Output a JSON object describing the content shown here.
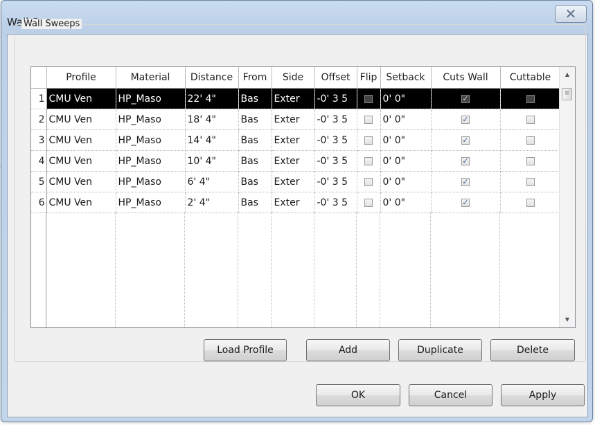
{
  "dialog": {
    "title": "Wall Sweeps",
    "close_glyph": "✕"
  },
  "group": {
    "label": "Wall Sweeps"
  },
  "grid": {
    "columns": [
      "Profile",
      "Material",
      "Distance",
      "From",
      "Side",
      "Offset",
      "Flip",
      "Setback",
      "Cuts Wall",
      "Cuttable"
    ],
    "rows": [
      {
        "num": "1",
        "profile": "CMU Ven",
        "material": "HP_Maso",
        "distance": "22'  4\"",
        "from": "Bas",
        "side": "Exter",
        "offset": "-0'  3 5",
        "flip": false,
        "setback": "0'  0\"",
        "cuts_wall": true,
        "cuttable": false,
        "selected": true
      },
      {
        "num": "2",
        "profile": "CMU Ven",
        "material": "HP_Maso",
        "distance": "18'  4\"",
        "from": "Bas",
        "side": "Exter",
        "offset": "-0'  3 5",
        "flip": false,
        "setback": "0'  0\"",
        "cuts_wall": true,
        "cuttable": false,
        "selected": false
      },
      {
        "num": "3",
        "profile": "CMU Ven",
        "material": "HP_Maso",
        "distance": "14'  4\"",
        "from": "Bas",
        "side": "Exter",
        "offset": "-0'  3 5",
        "flip": false,
        "setback": "0'  0\"",
        "cuts_wall": true,
        "cuttable": false,
        "selected": false
      },
      {
        "num": "4",
        "profile": "CMU Ven",
        "material": "HP_Maso",
        "distance": "10'  4\"",
        "from": "Bas",
        "side": "Exter",
        "offset": "-0'  3 5",
        "flip": false,
        "setback": "0'  0\"",
        "cuts_wall": true,
        "cuttable": false,
        "selected": false
      },
      {
        "num": "5",
        "profile": "CMU Ven",
        "material": "HP_Maso",
        "distance": "6'  4\"",
        "from": "Bas",
        "side": "Exter",
        "offset": "-0'  3 5",
        "flip": false,
        "setback": "0'  0\"",
        "cuts_wall": true,
        "cuttable": false,
        "selected": false
      },
      {
        "num": "6",
        "profile": "CMU Ven",
        "material": "HP_Maso",
        "distance": "2'  4\"",
        "from": "Bas",
        "side": "Exter",
        "offset": "-0'  3 5",
        "flip": false,
        "setback": "0'  0\"",
        "cuts_wall": true,
        "cuttable": false,
        "selected": false
      }
    ],
    "scroll_up_glyph": "▲",
    "scroll_down_glyph": "▼",
    "scroll_thumb_glyph": "≡"
  },
  "buttons": {
    "load_profile": "Load Profile",
    "add": "Add",
    "duplicate": "Duplicate",
    "delete": "Delete",
    "ok": "OK",
    "cancel": "Cancel",
    "apply": "Apply"
  },
  "colors": {
    "selection_bg": "#000000",
    "check_color": "#3b5a95"
  }
}
